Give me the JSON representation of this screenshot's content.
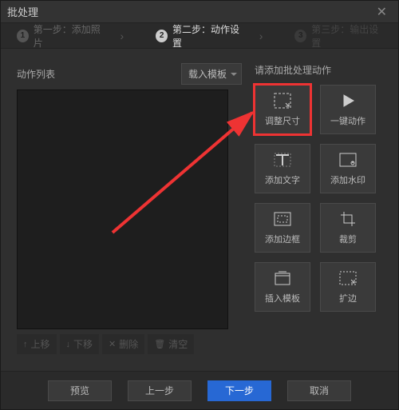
{
  "window": {
    "title": "批处理"
  },
  "steps": {
    "s1": {
      "num": "1",
      "label": "第一步：添加照片"
    },
    "s2": {
      "num": "2",
      "label": "第二步：动作设置"
    },
    "s3": {
      "num": "3",
      "label": "第三步：输出设置"
    }
  },
  "left": {
    "list_label": "动作列表",
    "load_template": "载入模板",
    "toolbar": {
      "up": "上移",
      "down": "下移",
      "delete": "删除",
      "clear": "清空"
    }
  },
  "right": {
    "prompt": "请添加批处理动作",
    "actions": {
      "resize": "调整尺寸",
      "oneclick": "一键动作",
      "text": "添加文字",
      "watermark": "添加水印",
      "border": "添加边框",
      "crop": "裁剪",
      "template": "插入模板",
      "expand": "扩边"
    }
  },
  "footer": {
    "preview": "预览",
    "prev": "上一步",
    "next": "下一步",
    "cancel": "取消"
  }
}
